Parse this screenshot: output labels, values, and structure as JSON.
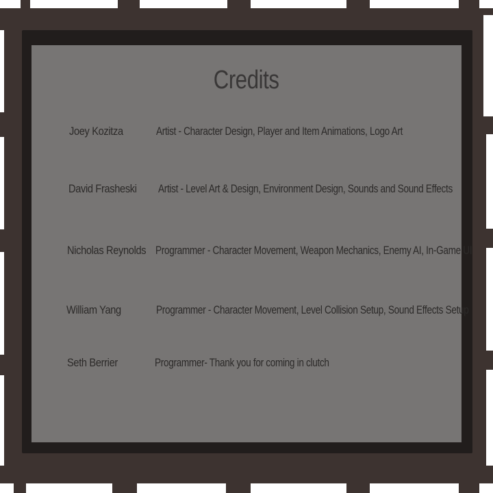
{
  "title": "Credits",
  "credits": [
    {
      "name": "Joey Kozitza",
      "role": "Artist - Character Design, Player and Item Animations, Logo Art"
    },
    {
      "name": "David Frasheski",
      "role": "Artist - Level Art & Design, Environment Design, Sounds and Sound Effects"
    },
    {
      "name": "Nicholas Reynolds",
      "role": "Programmer - Character Movement, Weapon Mechanics, Enemy AI, In-Game UI"
    },
    {
      "name": "William Yang",
      "role": "Programmer - Character Movement, Level Collision Setup, Sound Effects Setup"
    },
    {
      "name": "Seth Berrier",
      "role": "Programmer- Thank you for coming in clutch"
    }
  ]
}
